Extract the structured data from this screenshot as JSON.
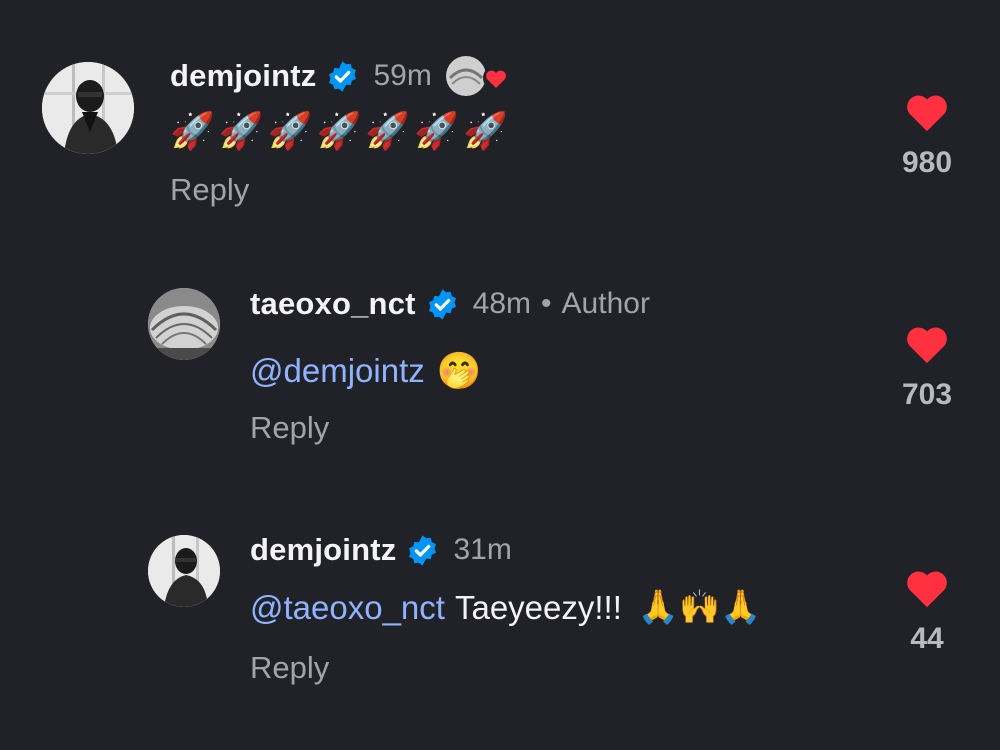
{
  "comments": [
    {
      "username": "demjointz",
      "time": "59m",
      "body_emoji": "🚀🚀🚀🚀🚀🚀🚀",
      "reply_label": "Reply",
      "likes": "980",
      "reaction_icon": "author-liked-icon"
    },
    {
      "username": "taeoxo_nct",
      "time": "48m",
      "dot": "•",
      "author_label": "Author",
      "mention": "@demjointz",
      "body_emoji": "🤭",
      "reply_label": "Reply",
      "likes": "703"
    },
    {
      "username": "demjointz",
      "time": "31m",
      "mention": "@taeoxo_nct",
      "body_text": "Taeyeezy!!!",
      "body_emoji": "🙏🙌🙏",
      "reply_label": "Reply",
      "likes": "44"
    }
  ],
  "colors": {
    "background": "#212227",
    "mention": "#8fb3ff",
    "heart": "#ff3040",
    "verified": "#0095f6"
  }
}
